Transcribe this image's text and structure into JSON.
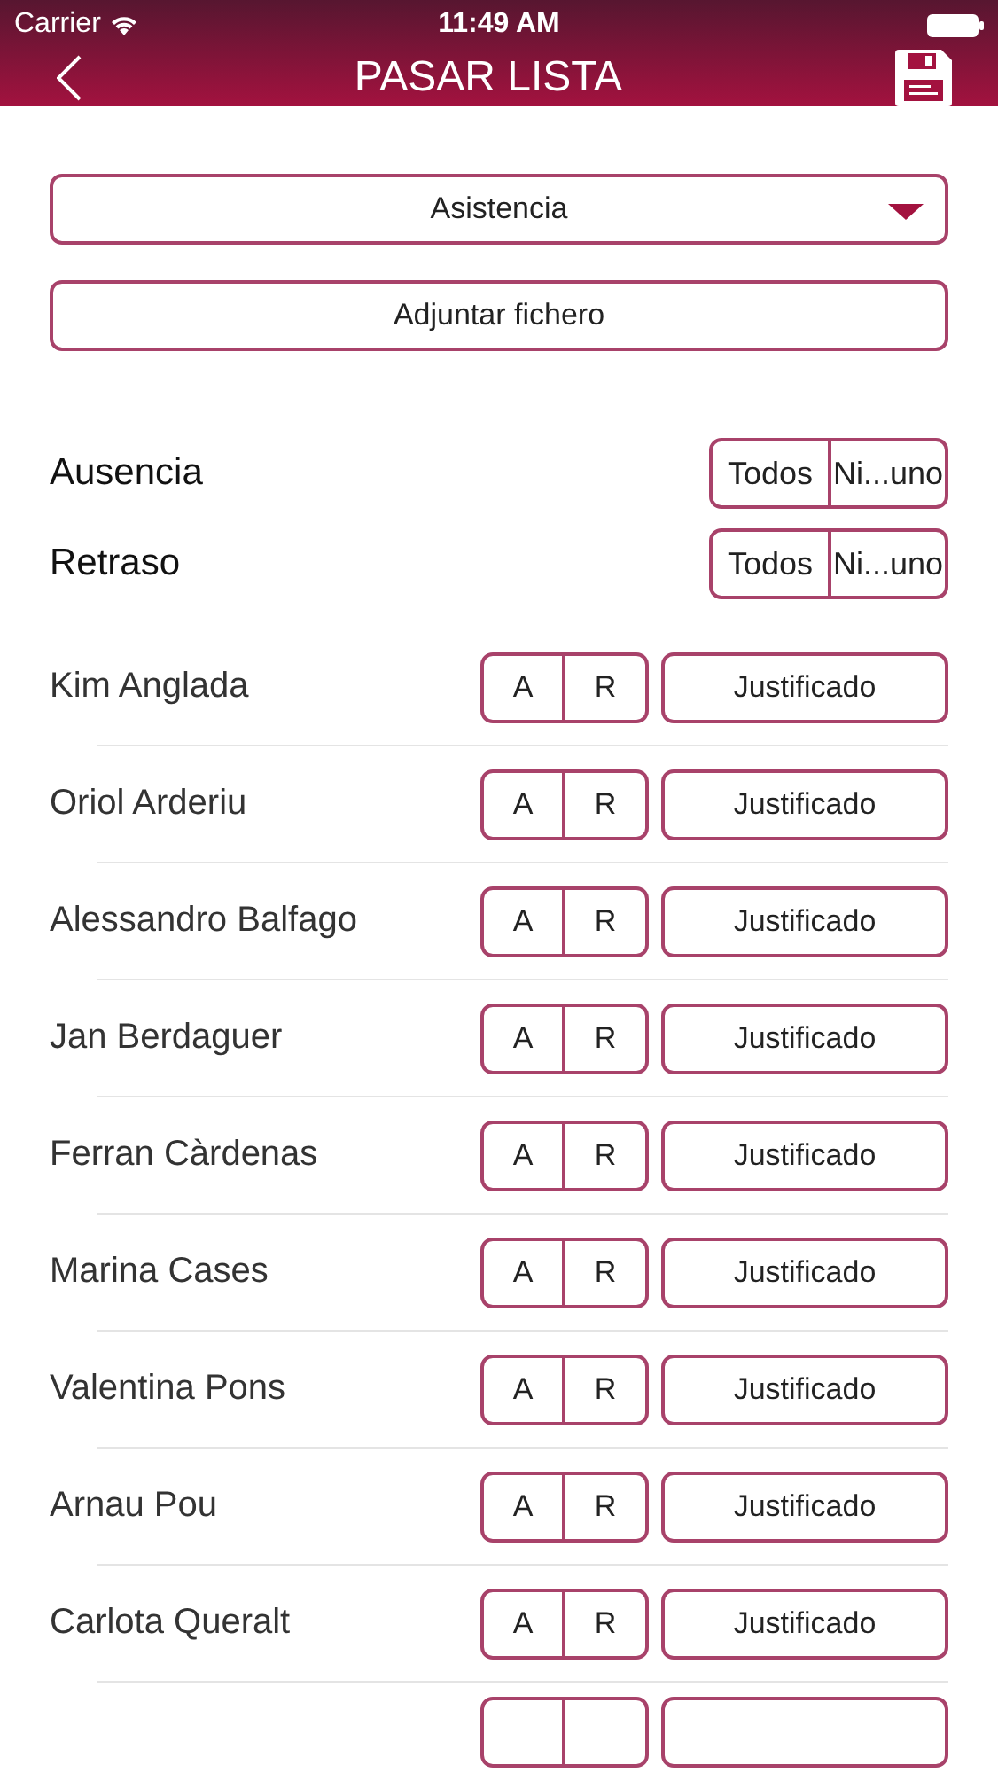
{
  "status_bar": {
    "carrier": "Carrier",
    "time": "11:49 AM"
  },
  "nav": {
    "title": "PASAR LISTA"
  },
  "type_select": {
    "value": "Asistencia"
  },
  "attach_button": "Adjuntar fichero",
  "bulk_rows": [
    {
      "label": "Ausencia",
      "all": "Todos",
      "none": "Ni...uno"
    },
    {
      "label": "Retraso",
      "all": "Todos",
      "none": "Ni...uno"
    }
  ],
  "students": [
    {
      "kind": "full",
      "name": "Kim Anglada",
      "absent": "A",
      "late": "R",
      "justify": "Justificado"
    },
    {
      "kind": "full",
      "name": "Oriol Arderiu",
      "absent": "A",
      "late": "R",
      "justify": "Justificado"
    },
    {
      "kind": "full",
      "name": "Alessandro Balfago",
      "absent": "A",
      "late": "R",
      "justify": "Justificado"
    },
    {
      "kind": "full",
      "name": "Jan Berdaguer",
      "absent": "A",
      "late": "R",
      "justify": "Justificado"
    },
    {
      "kind": "full",
      "name": "Ferran Càrdenas",
      "absent": "A",
      "late": "R",
      "justify": "Justificado"
    },
    {
      "kind": "full",
      "name": "Marina Cases",
      "absent": "A",
      "late": "R",
      "justify": "Justificado"
    },
    {
      "kind": "full",
      "name": "Valentina Pons",
      "absent": "A",
      "late": "R",
      "justify": "Justificado"
    },
    {
      "kind": "full",
      "name": "Arnau Pou",
      "absent": "A",
      "late": "R",
      "justify": "Justificado"
    },
    {
      "kind": "full",
      "name": "Carlota Queralt",
      "absent": "A",
      "late": "R",
      "justify": "Justificado"
    },
    {
      "kind": "cut"
    }
  ]
}
